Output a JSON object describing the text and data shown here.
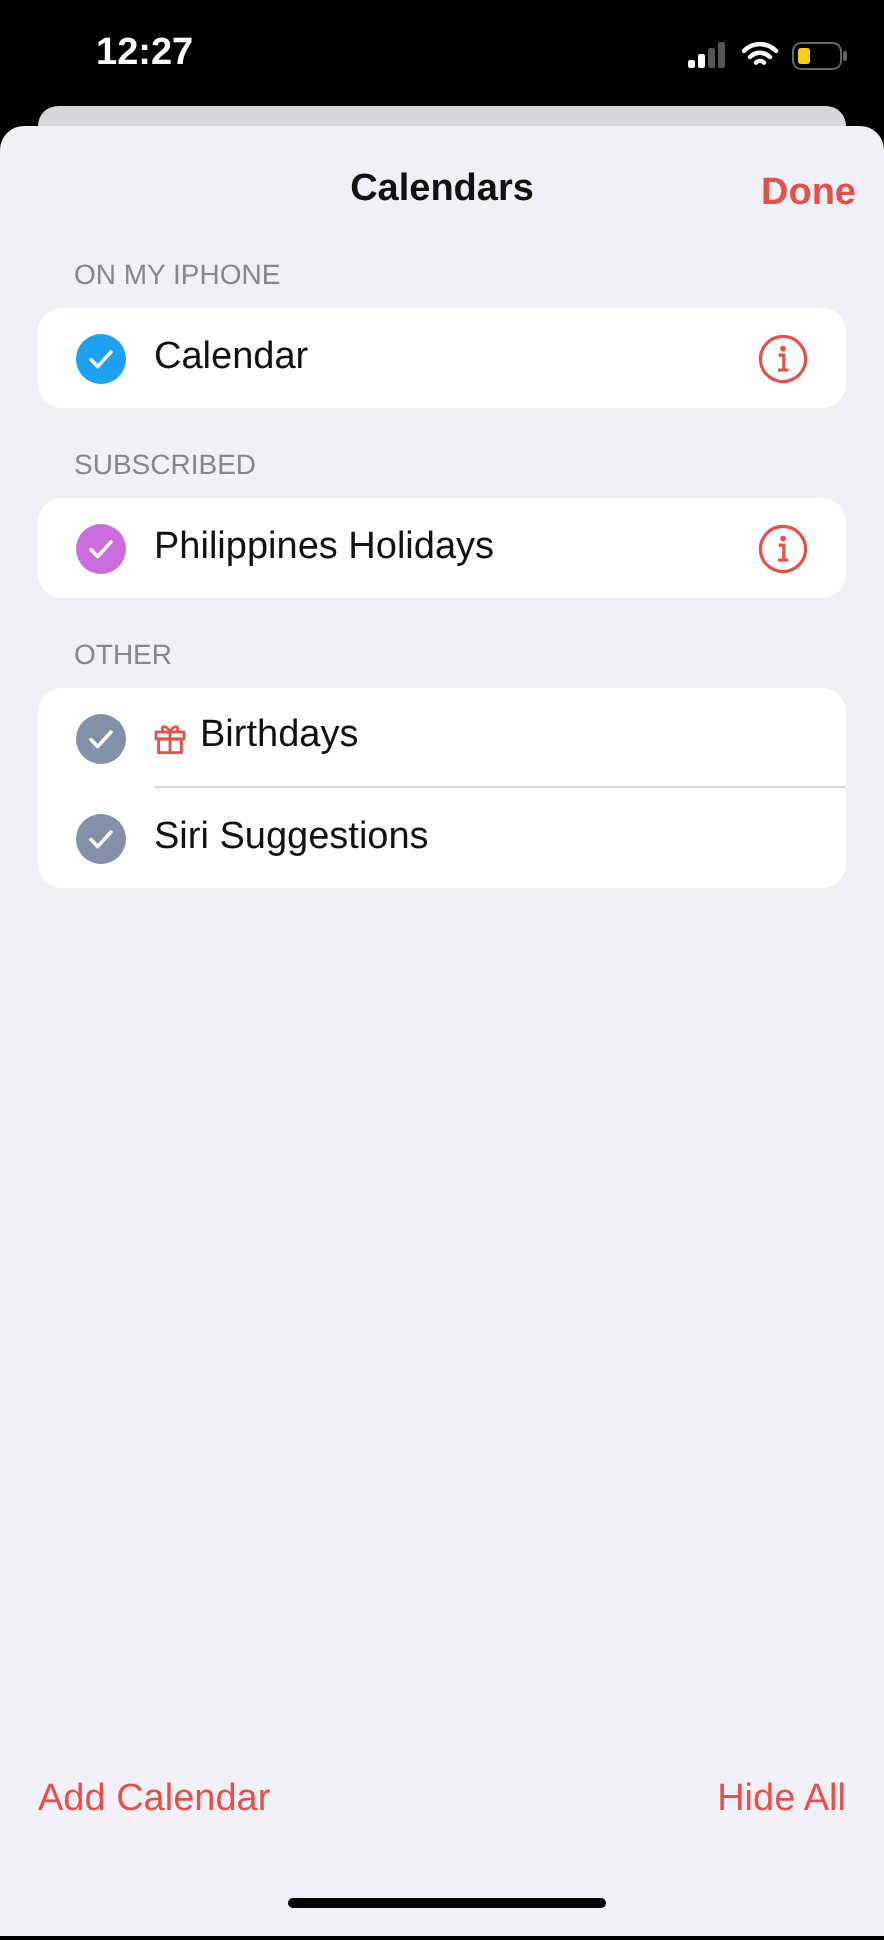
{
  "status_bar": {
    "time": "12:27"
  },
  "header": {
    "title": "Calendars",
    "done": "Done"
  },
  "sections": [
    {
      "title": "ON MY IPHONE",
      "items": [
        {
          "name": "Calendar",
          "checked": true,
          "color": "#1ea1f1",
          "info": true,
          "gift": false
        }
      ]
    },
    {
      "title": "SUBSCRIBED",
      "items": [
        {
          "name": "Philippines Holidays",
          "checked": true,
          "color": "#c86ddb",
          "info": true,
          "gift": false
        }
      ]
    },
    {
      "title": "OTHER",
      "items": [
        {
          "name": "Birthdays",
          "checked": true,
          "color": "#8390a8",
          "info": false,
          "gift": true
        },
        {
          "name": "Siri Suggestions",
          "checked": true,
          "color": "#8390a8",
          "info": false,
          "gift": false
        }
      ]
    }
  ],
  "footer": {
    "add": "Add Calendar",
    "hide": "Hide All"
  }
}
